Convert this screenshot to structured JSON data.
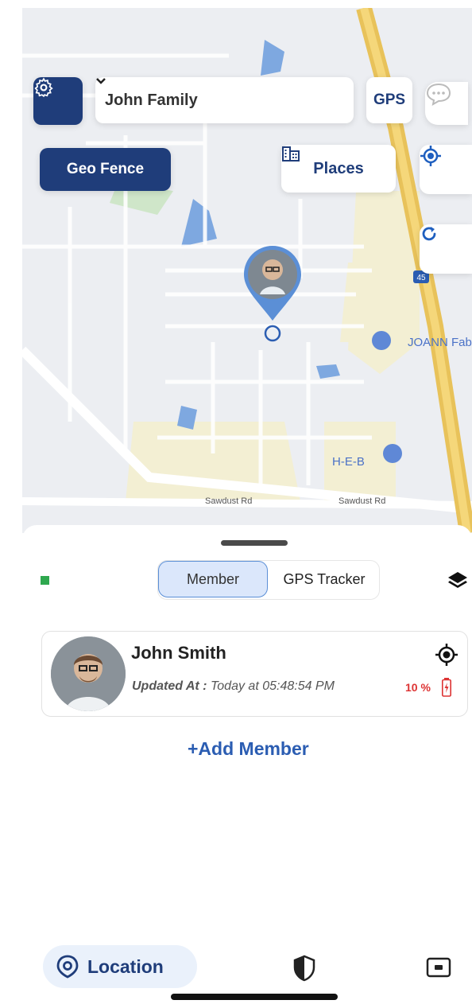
{
  "header": {
    "family_select": {
      "value": "John Family"
    },
    "gps_label": "GPS",
    "geo_fence_label": "Geo Fence",
    "places_label": "Places"
  },
  "map": {
    "roads": [
      "Sawdust Rd",
      "Sawdust Rd"
    ],
    "highway_shield": "45",
    "pois": [
      "JOANN Fab",
      "H-E-B"
    ]
  },
  "sheet": {
    "tabs": {
      "member": "Member",
      "gps_tracker": "GPS Tracker",
      "selected": "Member"
    },
    "member": {
      "name": "John Smith",
      "updated_label": "Updated At :",
      "updated_value": "Today at 05:48:54 PM",
      "battery": "10 %"
    },
    "add_member_label": "+Add Member"
  },
  "tabbar": {
    "location_label": "Location"
  },
  "colors": {
    "primary": "#1f3d7a",
    "accent_blue": "#2b5db2",
    "battery_low": "#dd3333",
    "online": "#2fa84f"
  }
}
